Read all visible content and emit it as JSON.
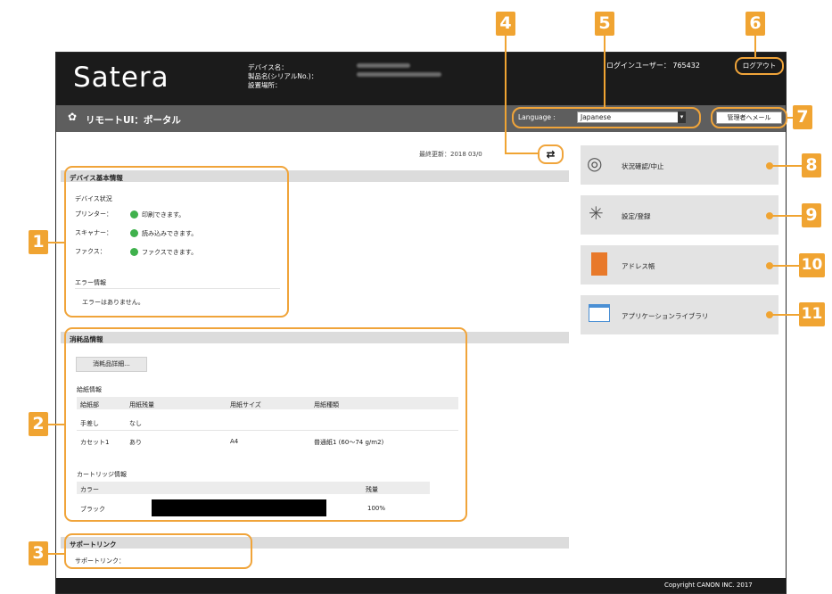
{
  "header": {
    "logo": "Satera",
    "device_name_label": "デバイス名：",
    "product_name_label": "製品名(シリアルNo.)：",
    "location_label": "設置場所：",
    "login_user": "ログインユーザー： 765432",
    "logout_label": "ログアウト"
  },
  "titlebar": {
    "title": "リモートUI：ポータル",
    "language_label": "Language :",
    "language_value": "Japanese",
    "admin_mail_label": "管理者へメール"
  },
  "last_updated": "最終更新：2018 03/0",
  "device_info": {
    "section_title": "デバイス基本情報",
    "status_title": "デバイス状況",
    "rows": [
      {
        "name": "プリンター：",
        "status": "印刷できます。"
      },
      {
        "name": "スキャナー：",
        "status": "読み込みできます。"
      },
      {
        "name": "ファクス：",
        "status": "ファクスできます。"
      }
    ],
    "error_title": "エラー情報",
    "error_text": "エラーはありません。"
  },
  "consumables": {
    "section_title": "消耗品情報",
    "details_button": "消耗品詳細...",
    "paper_title": "給紙情報",
    "paper_headers": [
      "給紙部",
      "用紙残量",
      "用紙サイズ",
      "用紙種類"
    ],
    "paper_rows": [
      [
        "手差し",
        "なし",
        "",
        ""
      ],
      [
        "カセット1",
        "あり",
        "A4",
        "普通紙1 (60～74 g/m2)"
      ]
    ],
    "cartridge_title": "カートリッジ情報",
    "cartridge_headers": [
      "カラー",
      "",
      "残量"
    ],
    "cartridge_rows": [
      {
        "color": "ブラック",
        "level": "100%",
        "level_value": 1.0
      }
    ]
  },
  "support": {
    "section_title": "サポートリンク",
    "link_label": "サポートリンク："
  },
  "menu": {
    "status_monitor": "状況確認/中止",
    "settings": "設定/登録",
    "address_book": "アドレス帳",
    "app_library": "アプリケーションライブラリ"
  },
  "callouts": [
    "1",
    "2",
    "3",
    "4",
    "5",
    "6",
    "7",
    "8",
    "9",
    "10",
    "11"
  ],
  "footer": {
    "copyright": "Copyright CANON INC. 2017"
  },
  "colors": {
    "accent": "#f0a432",
    "status_ok": "#3fb14c",
    "header_bg": "#1b1b1b",
    "titlebar_bg": "#5e5e5e"
  }
}
